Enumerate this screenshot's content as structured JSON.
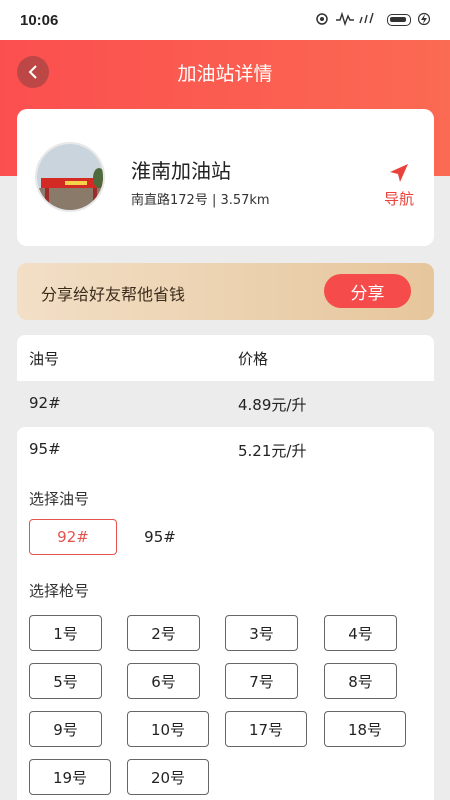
{
  "status_bar": {
    "time": "10:06"
  },
  "header": {
    "title": "加油站详情"
  },
  "station": {
    "name": "淮南加油站",
    "address": "南直路172号 | 3.57km",
    "nav_label": "导航"
  },
  "share": {
    "text": "分享给好友帮他省钱",
    "button": "分享"
  },
  "price_table": {
    "headers": [
      "油号",
      "价格"
    ],
    "rows": [
      [
        "92#",
        "4.89元/升"
      ],
      [
        "95#",
        "5.21元/升"
      ]
    ]
  },
  "fuel_select": {
    "label": "选择油号",
    "options": [
      "92#",
      "95#"
    ],
    "selected": "92#"
  },
  "nozzle_select": {
    "label": "选择枪号",
    "options": [
      "1号",
      "2号",
      "3号",
      "4号",
      "5号",
      "6号",
      "7号",
      "8号",
      "9号",
      "10号",
      "17号",
      "18号",
      "19号",
      "20号"
    ]
  },
  "colors": {
    "accent": "#f64b4b",
    "header": "#fb4f4f"
  }
}
